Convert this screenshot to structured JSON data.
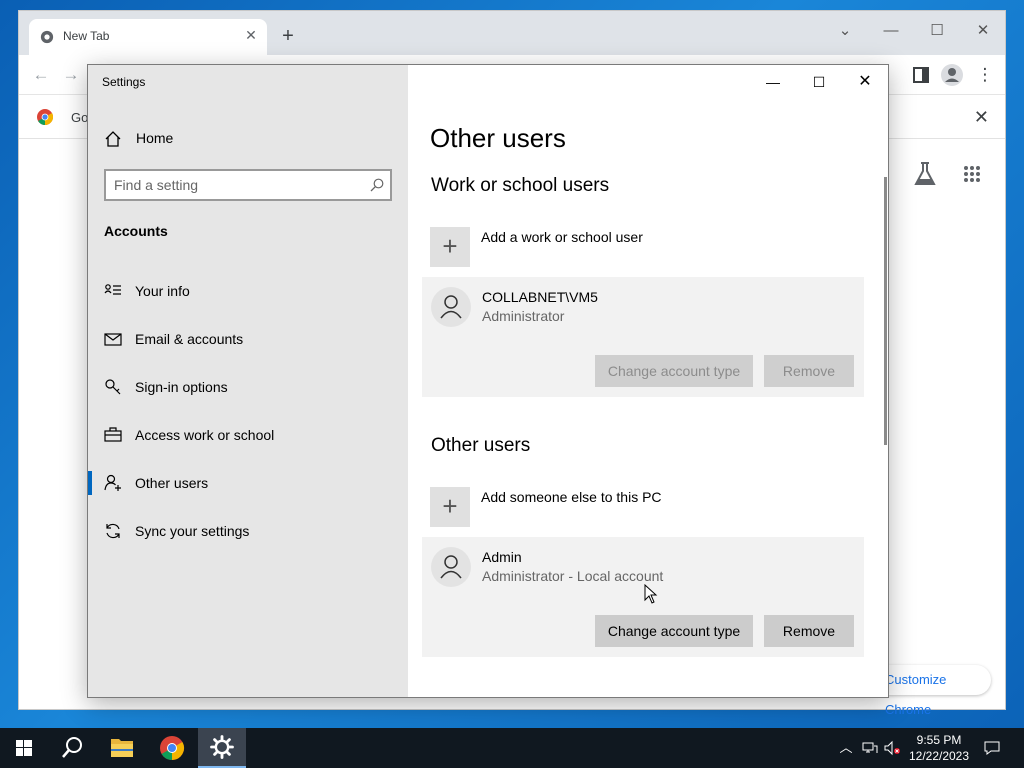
{
  "chrome": {
    "tab_title": "New Tab",
    "new_tab": "+",
    "bookmark_label": "Go",
    "customize_label": "Customize Chrome"
  },
  "settings": {
    "window_title": "Settings",
    "sidebar": {
      "home": "Home",
      "search_placeholder": "Find a setting",
      "section": "Accounts",
      "items": [
        {
          "label": "Your info",
          "icon": "your-info-icon"
        },
        {
          "label": "Email & accounts",
          "icon": "mail-icon"
        },
        {
          "label": "Sign-in options",
          "icon": "key-icon"
        },
        {
          "label": "Access work or school",
          "icon": "briefcase-icon"
        },
        {
          "label": "Other users",
          "icon": "add-person-icon",
          "active": true
        },
        {
          "label": "Sync your settings",
          "icon": "sync-icon"
        }
      ]
    },
    "main": {
      "title": "Other users",
      "work_section": {
        "heading": "Work or school users",
        "add_label": "Add a work or school user",
        "user": {
          "name": "COLLABNET\\VM5",
          "role": "Administrator"
        },
        "change_label": "Change account type",
        "remove_label": "Remove"
      },
      "other_section": {
        "heading": "Other users",
        "add_label": "Add someone else to this PC",
        "user": {
          "name": "Admin",
          "role": "Administrator - Local account"
        },
        "change_label": "Change account type",
        "remove_label": "Remove"
      }
    }
  },
  "taskbar": {
    "time": "9:55 PM",
    "date": "12/22/2023"
  },
  "colors": {
    "accent": "#0067c0",
    "sidebar_bg": "#e6e6e6",
    "card_bg": "#f2f2f2",
    "taskbar_bg": "#101820"
  }
}
